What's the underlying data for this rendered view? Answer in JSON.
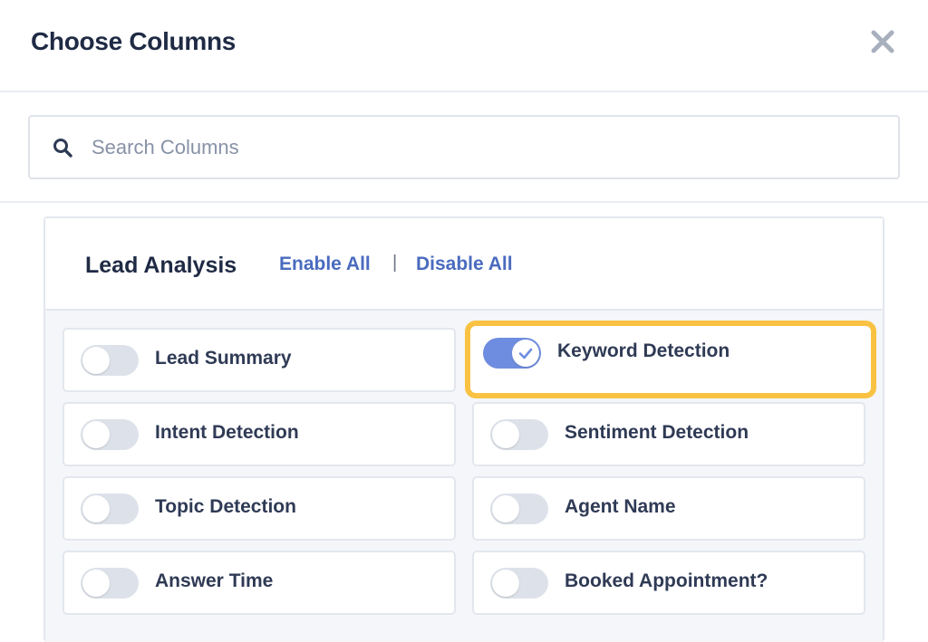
{
  "dialog": {
    "title": "Choose Columns",
    "close_icon": "close-icon"
  },
  "search": {
    "placeholder": "Search Columns",
    "value": "",
    "icon": "search-icon"
  },
  "section": {
    "title": "Lead Analysis",
    "enable_all": "Enable All",
    "separator": "|",
    "disable_all": "Disable All",
    "columns": [
      {
        "label": "Lead Summary",
        "enabled": false
      },
      {
        "label": "Keyword Detection",
        "enabled": true,
        "highlighted": true
      },
      {
        "label": "Intent Detection",
        "enabled": false
      },
      {
        "label": "Sentiment Detection",
        "enabled": false
      },
      {
        "label": "Topic Detection",
        "enabled": false
      },
      {
        "label": "Agent Name",
        "enabled": false
      },
      {
        "label": "Answer Time",
        "enabled": false
      },
      {
        "label": "Booked Appointment?",
        "enabled": false
      }
    ]
  },
  "colors": {
    "title": "#1f2a44",
    "link": "#4a6bbf",
    "toggle_on": "#6f8de0",
    "toggle_off": "#dde2ea",
    "highlight": "#f9c242"
  }
}
